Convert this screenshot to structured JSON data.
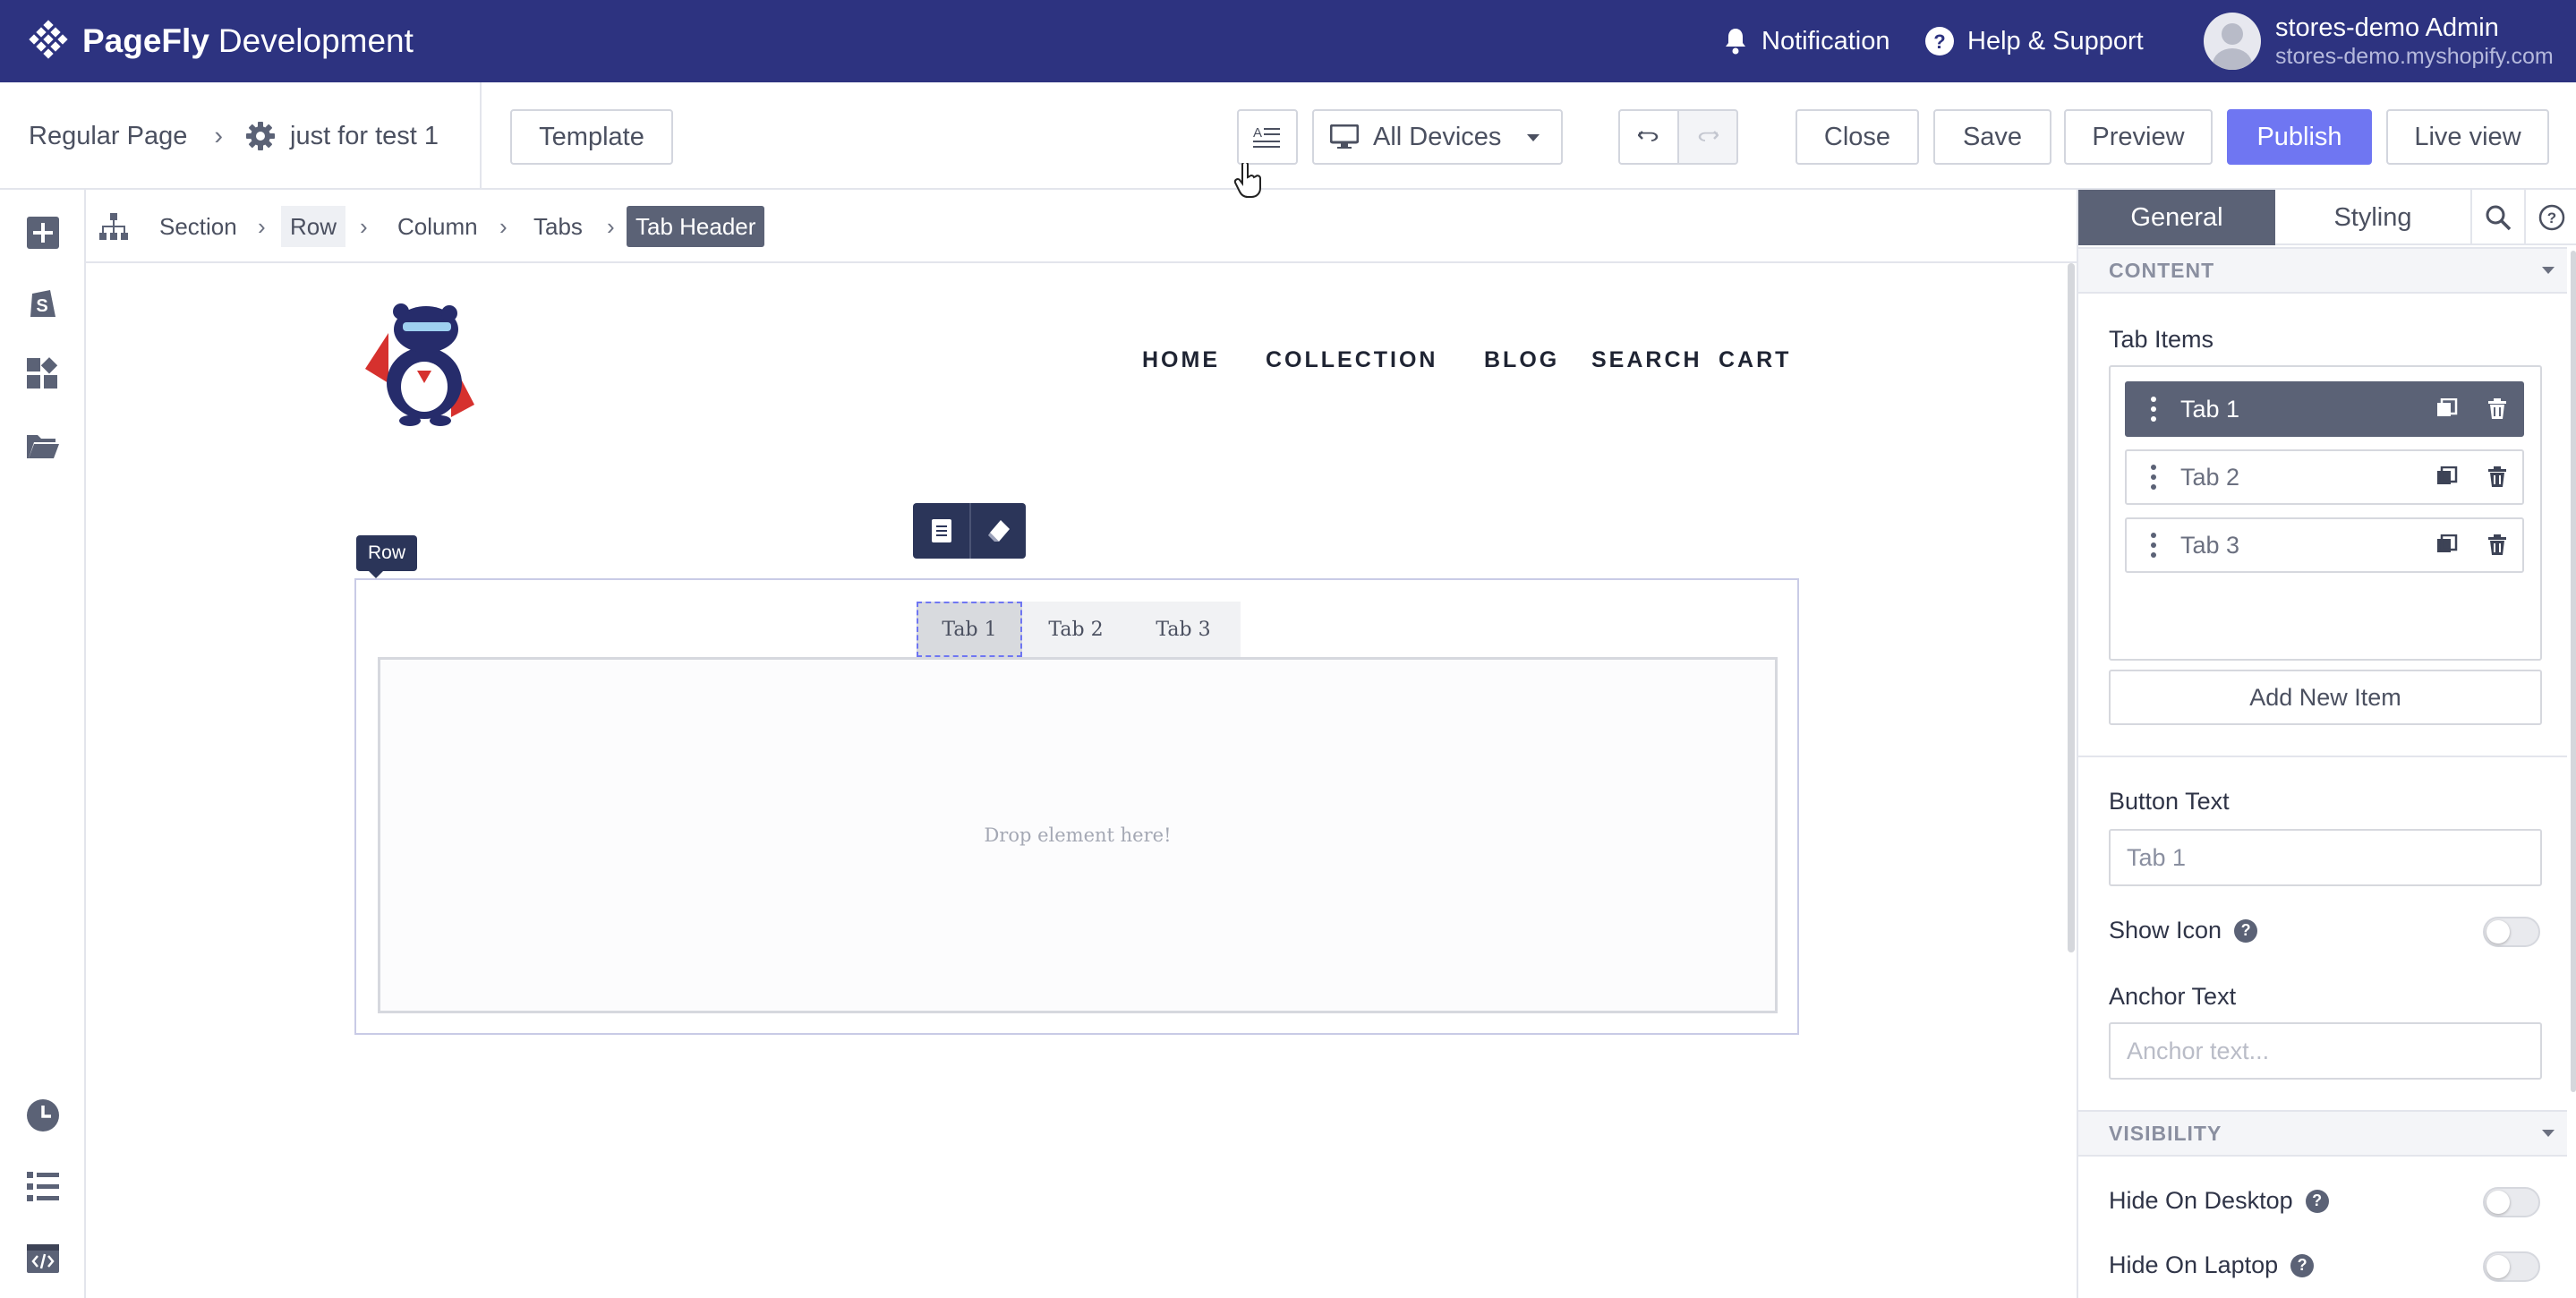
{
  "app": {
    "brand_bold": "PageFly",
    "brand_light": "Development",
    "notification_label": "Notification",
    "help_label": "Help & Support",
    "user_name": "stores-demo Admin",
    "user_store": "stores-demo.myshopify.com"
  },
  "toolbar": {
    "page_type": "Regular Page",
    "page_name": "just for test 1",
    "template_label": "Template",
    "device_label": "All Devices",
    "close_label": "Close",
    "save_label": "Save",
    "preview_label": "Preview",
    "publish_label": "Publish",
    "live_view_label": "Live view"
  },
  "breadcrumb": {
    "items": [
      "Section",
      "Row",
      "Column",
      "Tabs",
      "Tab Header"
    ]
  },
  "canvas": {
    "nav_links": [
      "HOME",
      "COLLECTION",
      "BLOG",
      "SEARCH",
      "CART"
    ],
    "row_label": "Row",
    "tabs": [
      "Tab 1",
      "Tab 2",
      "Tab 3"
    ],
    "drop_text": "Drop element here!"
  },
  "panel": {
    "tabs": [
      "General",
      "Styling"
    ],
    "content_header": "CONTENT",
    "tab_items_label": "Tab Items",
    "items": [
      "Tab 1",
      "Tab 2",
      "Tab 3"
    ],
    "add_item_label": "Add New Item",
    "button_text_label": "Button Text",
    "button_text_value": "Tab 1",
    "show_icon_label": "Show Icon",
    "anchor_text_label": "Anchor Text",
    "anchor_placeholder": "Anchor text...",
    "visibility_header": "VISIBILITY",
    "hide_desktop_label": "Hide On Desktop",
    "hide_laptop_label": "Hide On Laptop"
  },
  "colors": {
    "topbar": "#2d3380",
    "primary": "#6f76f2",
    "selected_item": "#5b6276"
  }
}
